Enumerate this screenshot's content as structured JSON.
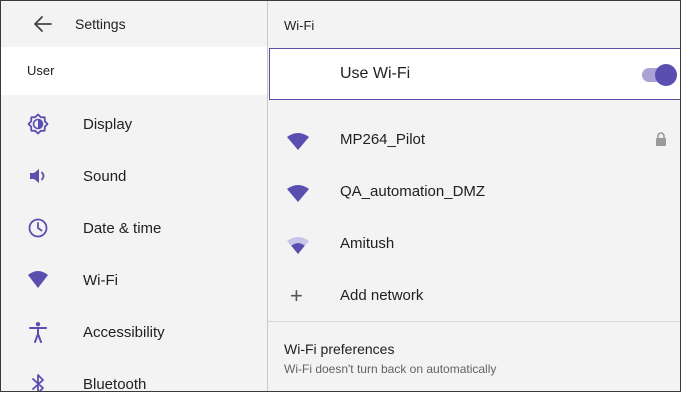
{
  "left": {
    "title": "Settings",
    "section": "User",
    "items": [
      {
        "label": "Display",
        "icon": "brightness-icon"
      },
      {
        "label": "Sound",
        "icon": "speaker-icon"
      },
      {
        "label": "Date & time",
        "icon": "clock-icon"
      },
      {
        "label": "Wi-Fi",
        "icon": "wifi-icon"
      },
      {
        "label": "Accessibility",
        "icon": "accessibility-icon"
      },
      {
        "label": "Bluetooth",
        "icon": "bluetooth-icon"
      }
    ]
  },
  "right": {
    "title": "Wi-Fi",
    "use_wifi_label": "Use Wi-Fi",
    "use_wifi_on": true,
    "networks": [
      {
        "name": "MP264_Pilot",
        "locked": true
      },
      {
        "name": "QA_automation_DMZ",
        "locked": false
      },
      {
        "name": "Amitush",
        "locked": false
      }
    ],
    "add_network_label": "Add network",
    "preferences_title": "Wi-Fi preferences",
    "preferences_subtitle": "Wi-Fi doesn't turn back on automatically"
  },
  "colors": {
    "accent": "#5a4fb0",
    "accent_track": "#a9a3d6",
    "pane_bg": "#f3f3f3",
    "icon": "#5a4fb0"
  }
}
